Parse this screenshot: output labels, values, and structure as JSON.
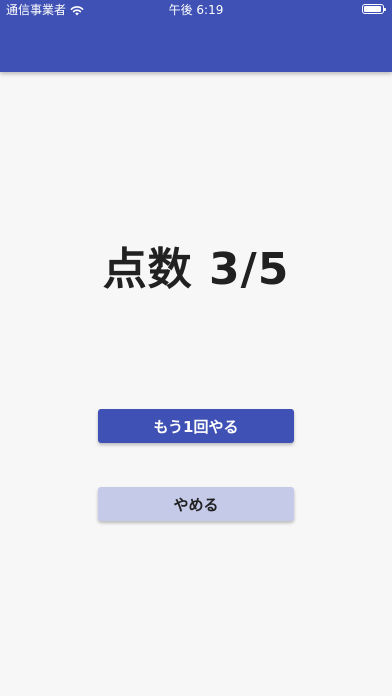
{
  "status_bar": {
    "carrier": "通信事業者",
    "time": "午後 6:19",
    "wifi_icon": "wifi-icon",
    "battery_icon": "battery-icon"
  },
  "app_bar": {
    "color": "#3f51b5"
  },
  "result": {
    "score_text": "点数 3/5"
  },
  "actions": {
    "retry_label": "もう1回やる",
    "quit_label": "やめる",
    "retry_color": "#3f51b5",
    "quit_color": "#c5cae9"
  }
}
